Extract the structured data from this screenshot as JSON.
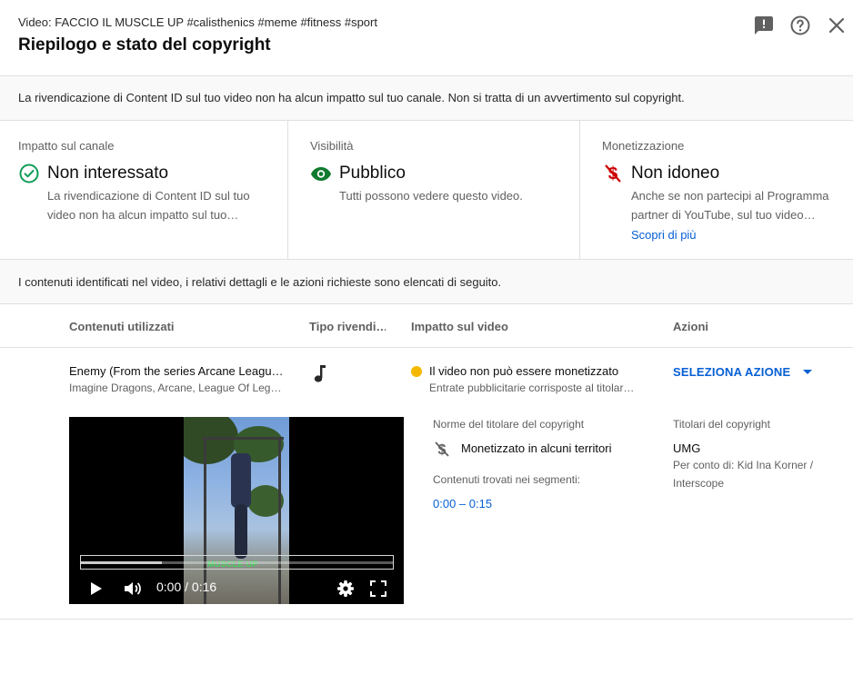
{
  "header": {
    "video_title": "Video: FACCIO IL MUSCLE UP #calisthenics #meme #fitness #sport",
    "title": "Riepilogo e stato del copyright",
    "icons": [
      "feedback-icon",
      "help-icon",
      "close-icon"
    ]
  },
  "banner": {
    "text": "La rivendicazione di Content ID sul tuo video non ha alcun impatto sul tuo canale. Non si tratta di un avvertimento sul copyright."
  },
  "cards": {
    "impact": {
      "label": "Impatto sul canale",
      "value": "Non interessato",
      "desc": "La rivendicazione di Content ID sul tuo video non ha alcun impatto sul tuo…",
      "icon": "check-circle-icon",
      "icon_color": "#0f9d58"
    },
    "visibility": {
      "label": "Visibilità",
      "value": "Pubblico",
      "desc": "Tutti possono vedere questo video.",
      "icon": "eye-icon",
      "icon_color": "#0f7a2e"
    },
    "monetization": {
      "label": "Monetizzazione",
      "value": "Non idoneo",
      "desc": "Anche se non partecipi al Programma partner di YouTube, sul tuo video…",
      "link": "Scopri di più",
      "icon": "no-money-icon",
      "icon_color": "#cc0000"
    }
  },
  "info_strip": {
    "text": "I contenuti identificati nel video, i relativi dettagli e le azioni richieste sono elencati di seguito."
  },
  "table": {
    "headers": {
      "content": "Contenuti utilizzati",
      "claim_type": "Tipo rivendi…",
      "impact": "Impatto sul video",
      "actions": "Azioni"
    },
    "row": {
      "content_title": "Enemy (From the series Arcane Leagu…",
      "content_artists": "Imagine Dragons, Arcane, League Of Leg…",
      "claim_icon": "music-note-icon",
      "impact_title": "Il video non può essere monetizzato",
      "impact_sub": "Entrate pubblicitarie corrisposte al titolar…",
      "impact_dot_color": "#f5b800",
      "action_label": "SELEZIONA AZIONE"
    }
  },
  "player": {
    "overlay_caption": "MUSCLE UP",
    "time": "0:00 / 0:16",
    "played_fraction": 0,
    "buffered_fraction": 0.26
  },
  "details": {
    "policy_label": "Norme del titolare del copyright",
    "policy_value": "Monetizzato in alcuni territori",
    "policy_icon": "no-money-icon",
    "segments_label": "Contenuti trovati nei segmenti:",
    "segment": "0:00 – 0:15",
    "owners_label": "Titolari del copyright",
    "owner": "UMG",
    "on_behalf": "Per conto di: Kid Ina Korner / Interscope"
  }
}
